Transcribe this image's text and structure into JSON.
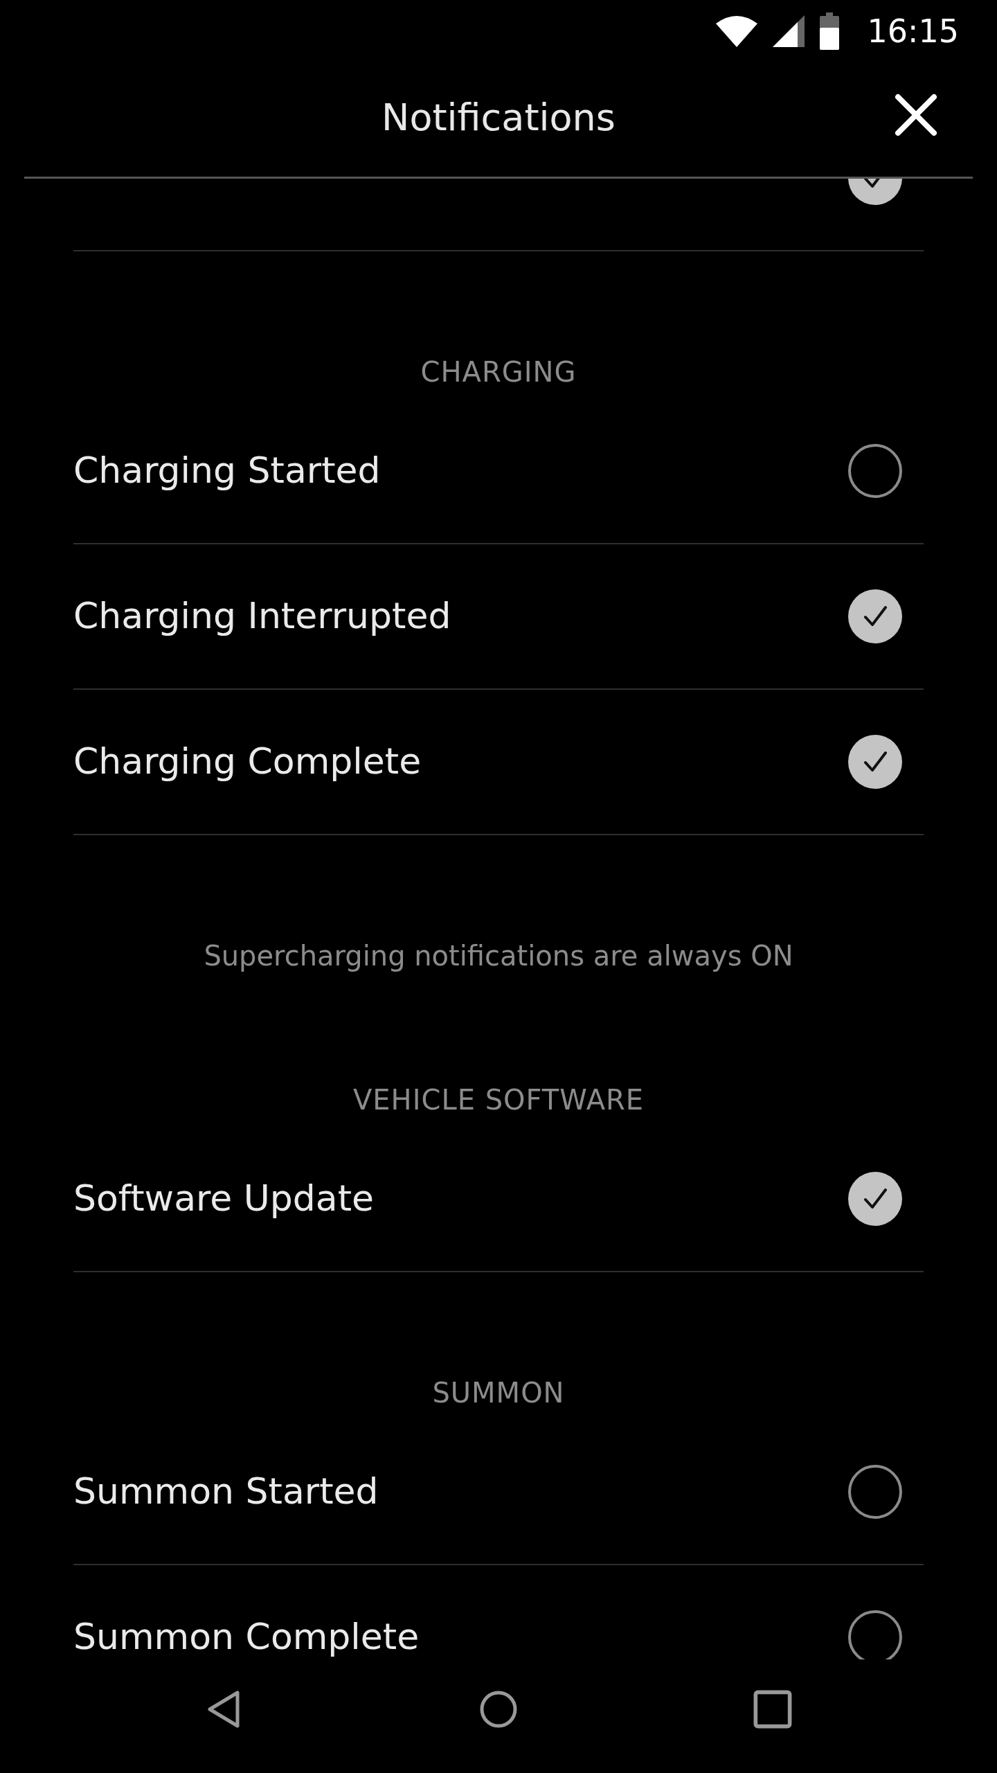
{
  "status_bar": {
    "time": "16:15"
  },
  "header": {
    "title": "Notifications"
  },
  "sections": [
    {
      "items": [
        {
          "checked": true
        }
      ]
    },
    {
      "heading": "CHARGING",
      "items": [
        {
          "label": "Charging Started",
          "checked": false
        },
        {
          "label": "Charging Interrupted",
          "checked": true
        },
        {
          "label": "Charging Complete",
          "checked": true
        }
      ],
      "note": "Supercharging notifications are always ON"
    },
    {
      "heading": "VEHICLE SOFTWARE",
      "items": [
        {
          "label": "Software Update",
          "checked": true
        }
      ]
    },
    {
      "heading": "SUMMON",
      "items": [
        {
          "label": "Summon Started",
          "checked": false
        },
        {
          "label": "Summon Complete",
          "checked": false
        }
      ]
    }
  ]
}
